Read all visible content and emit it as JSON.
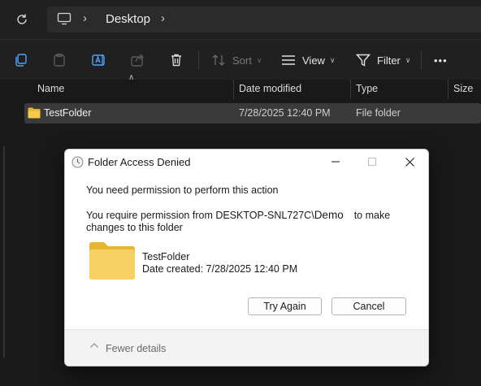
{
  "address": {
    "crumb": "Desktop"
  },
  "toolbar": {
    "sort_label": "Sort",
    "view_label": "View",
    "filter_label": "Filter",
    "more_label": "•••"
  },
  "columns": {
    "name": "Name",
    "date_modified": "Date modified",
    "type": "Type",
    "size": "Size"
  },
  "files": [
    {
      "name": "TestFolder",
      "date": "7/28/2025 12:40 PM",
      "type": "File folder"
    }
  ],
  "dialog": {
    "title": "Folder Access Denied",
    "message1": "You need permission to perform this action",
    "message2_prefix": "You require permission from DESKTOP-SNL727C\\",
    "message2_user": "Demo",
    "message2_suffix": "to make changes to this folder",
    "folder_name": "TestFolder",
    "folder_date": "Date created: 7/28/2025 12:40 PM",
    "try_again": "Try Again",
    "cancel": "Cancel",
    "fewer_details": "Fewer details"
  },
  "colors": {
    "background": "#191919",
    "selected_row": "#3a3a3a",
    "folder_yellow": "#f7c948"
  }
}
